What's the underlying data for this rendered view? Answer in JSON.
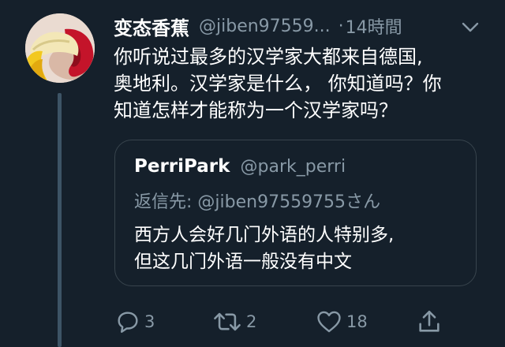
{
  "tweet": {
    "display_name": "变态香蕉",
    "handle": "@jiben97559...",
    "separator": "·",
    "time": "14時間",
    "body_lines": [
      "你听说过最多的汉学家大都来自德国,",
      "奥地利。汉学家是什么， 你知道吗？你",
      "知道怎样才能称为一个汉学家吗？"
    ]
  },
  "quote": {
    "display_name": "PerriPark",
    "handle": "@park_perri",
    "reply_prefix": "返信先: ",
    "reply_to": "@jiben97559755",
    "reply_suffix": "さん",
    "body_lines": [
      "西方人会好几门外语的人特别多,",
      "但这几门外语一般没有中文"
    ]
  },
  "actions": {
    "reply_count": "3",
    "retweet_count": "2",
    "like_count": "18"
  },
  "icons": {
    "reply": "reply-icon",
    "retweet": "retweet-icon",
    "like": "heart-icon",
    "share": "share-icon",
    "more": "chevron-down-icon"
  },
  "colors": {
    "background": "#15202b",
    "secondary_text": "#8899a6",
    "border": "#38444d"
  }
}
